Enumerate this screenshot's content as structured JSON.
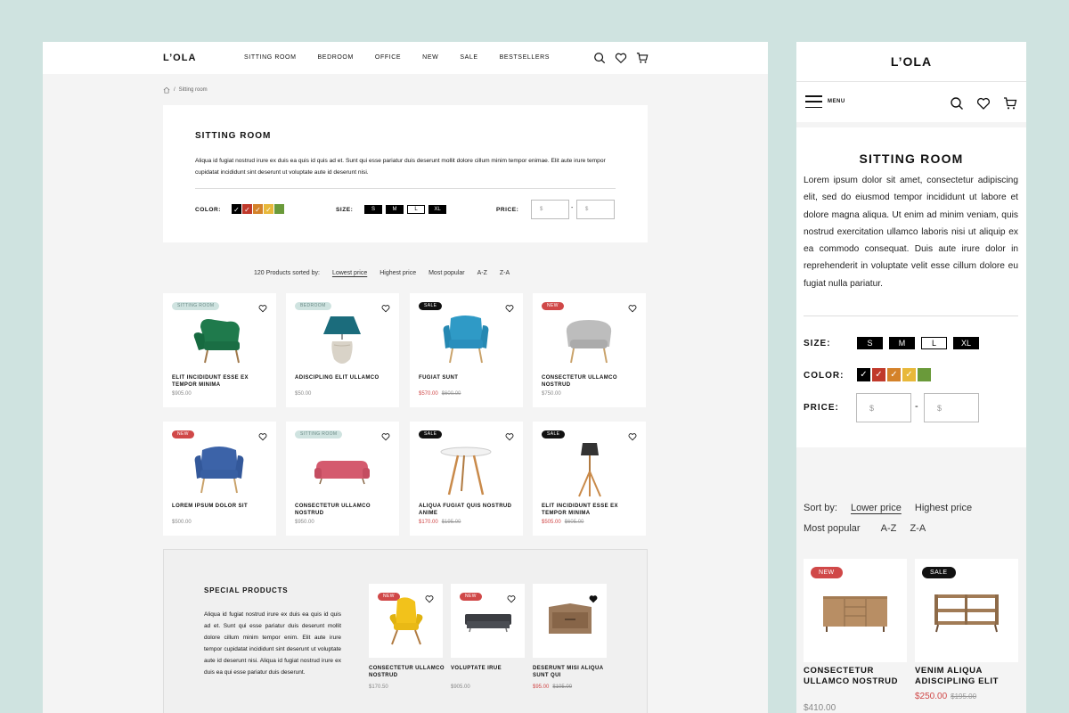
{
  "brand": "L’OLA",
  "nav": [
    "SITTING ROOM",
    "BEDROOM",
    "OFFICE",
    "NEW",
    "SALE",
    "BESTSELLERS"
  ],
  "breadcrumb": {
    "current": "Sitting room",
    "separator": "/"
  },
  "intro": {
    "title": "SITTING ROOM",
    "text": "Aliqua id fugiat nostrud irure ex duis ea quis id quis ad et. Sunt qui esse pariatur duis deserunt mollit dolore cillum minim tempor enimae. Elit aute irure tempor cupidatat incididunt sint deserunt ut voluptate aute id deserunt nisi."
  },
  "filters": {
    "color_label": "COLOR:",
    "size_label": "SIZE:",
    "price_label": "PRICE:",
    "sizes": [
      "S",
      "M",
      "L",
      "XL"
    ],
    "selected_size": "L",
    "colors": [
      "#000000",
      "#c0392b",
      "#d4822a",
      "#e8b83a",
      "#6a9a3a"
    ],
    "price_min_placeholder": "$",
    "price_max_placeholder": "$",
    "dash": "-"
  },
  "sort": {
    "summary": "120 Products sorted by:",
    "options": [
      "Lowest price",
      "Highest price",
      "Most popular",
      "A-Z",
      "Z-A"
    ],
    "active": "Lowest price"
  },
  "products": [
    {
      "badge": "SITTING ROOM",
      "badge_type": "cat",
      "name": "ELIT INCIDIDUNT ESSE EX TEMPOR MINIMA",
      "price": "$905.00",
      "old_price": "",
      "image": "green-armchair"
    },
    {
      "badge": "BEDROOM",
      "badge_type": "cat",
      "name": "ADISCIPLING ELIT ULLAMCO",
      "price": "$50.00",
      "old_price": "",
      "image": "teal-lamp"
    },
    {
      "badge": "SALE",
      "badge_type": "sale",
      "name": "FUGIAT SUNT",
      "price": "$570.00",
      "old_price": "$600.00",
      "image": "blue-armchair"
    },
    {
      "badge": "NEW",
      "badge_type": "new",
      "name": "CONSECTETUR ULLAMCO NOSTRUD",
      "price": "$750.00",
      "old_price": "",
      "image": "grey-armchair"
    },
    {
      "badge": "NEW",
      "badge_type": "new",
      "name": "LOREM IPSUM DOLOR SIT",
      "price": "$500.00",
      "old_price": "",
      "image": "navy-armchair"
    },
    {
      "badge": "SITTING ROOM",
      "badge_type": "cat",
      "name": "CONSECTETUR ULLAMCO NOSTRUD",
      "price": "$950.00",
      "old_price": "",
      "image": "pink-sofa"
    },
    {
      "badge": "SALE",
      "badge_type": "sale",
      "name": "ALIQUA FUGIAT QUIS NOSTRUD ANIME",
      "price": "$170.00",
      "old_price": "$195.00",
      "image": "round-table"
    },
    {
      "badge": "SALE",
      "badge_type": "sale",
      "name": "ELIT INCIDIDUNT ESSE EX TEMPOR MINIMA",
      "price": "$505.00",
      "old_price": "$605.00",
      "image": "floor-lamp"
    }
  ],
  "special": {
    "title": "SPECIAL PRODUCTS",
    "text": "Aliqua id fugiat nostrud irure ex duis ea quis id quis ad et. Sunt qui esse pariatur duis deserunt mollit dolore cillum minim tempor enim. Elit aute irure tempor cupidatat incididunt sint deserunt ut voluptate aute id deserunt nisi. Aliqua id fugiat nostrud irure ex duis ea qui esse pariatur duis deserunt.",
    "items": [
      {
        "badge": "NEW",
        "name": "CONSECTETUR ULLAMCO NOSTRUD",
        "price": "$170.50",
        "old_price": "",
        "image": "yellow-chair",
        "liked": false
      },
      {
        "badge": "NEW",
        "name": "VOLUPTATE IRUE",
        "price": "$905.00",
        "old_price": "",
        "image": "grey-sofa",
        "liked": false
      },
      {
        "badge": "",
        "name": "DESERUNT MISI ALIQUA SUNT QUI",
        "price": "$95.00",
        "old_price": "$105.00",
        "image": "wood-nightstand",
        "liked": true
      }
    ]
  },
  "mobile": {
    "menu_label": "MENU",
    "title": "SITTING ROOM",
    "text": "Lorem ipsum dolor sit amet, consectetur adipiscing elit, sed do eiusmod tempor incididunt ut labore et dolore magna aliqua. Ut enim ad minim veniam, quis nostrud exercitation ullamco laboris nisi ut aliquip ex ea commodo consequat. Duis aute irure dolor in reprehenderit in voluptate velit esse cillum dolore eu fugiat nulla pariatur.",
    "size_label": "SIZE:",
    "color_label": "COLOR:",
    "price_label": "PRICE:",
    "sort_label": "Sort by:",
    "sort_options": [
      "Lower price",
      "Highest price",
      "Most popular",
      "A-Z",
      "Z-A"
    ],
    "sort_active": "Lower price",
    "products": [
      {
        "badge": "NEW",
        "badge_type": "new",
        "name": "CONSECTETUR ULLAMCO NOSTRUD",
        "price": "$410.00",
        "old_price": "",
        "image": "wood-sideboard"
      },
      {
        "badge": "SALE",
        "badge_type": "sale",
        "name": "VENIM ALIQUA ADISCIPLING ELIT",
        "price": "$250.00",
        "old_price": "$195.00",
        "image": "tv-console"
      }
    ]
  }
}
